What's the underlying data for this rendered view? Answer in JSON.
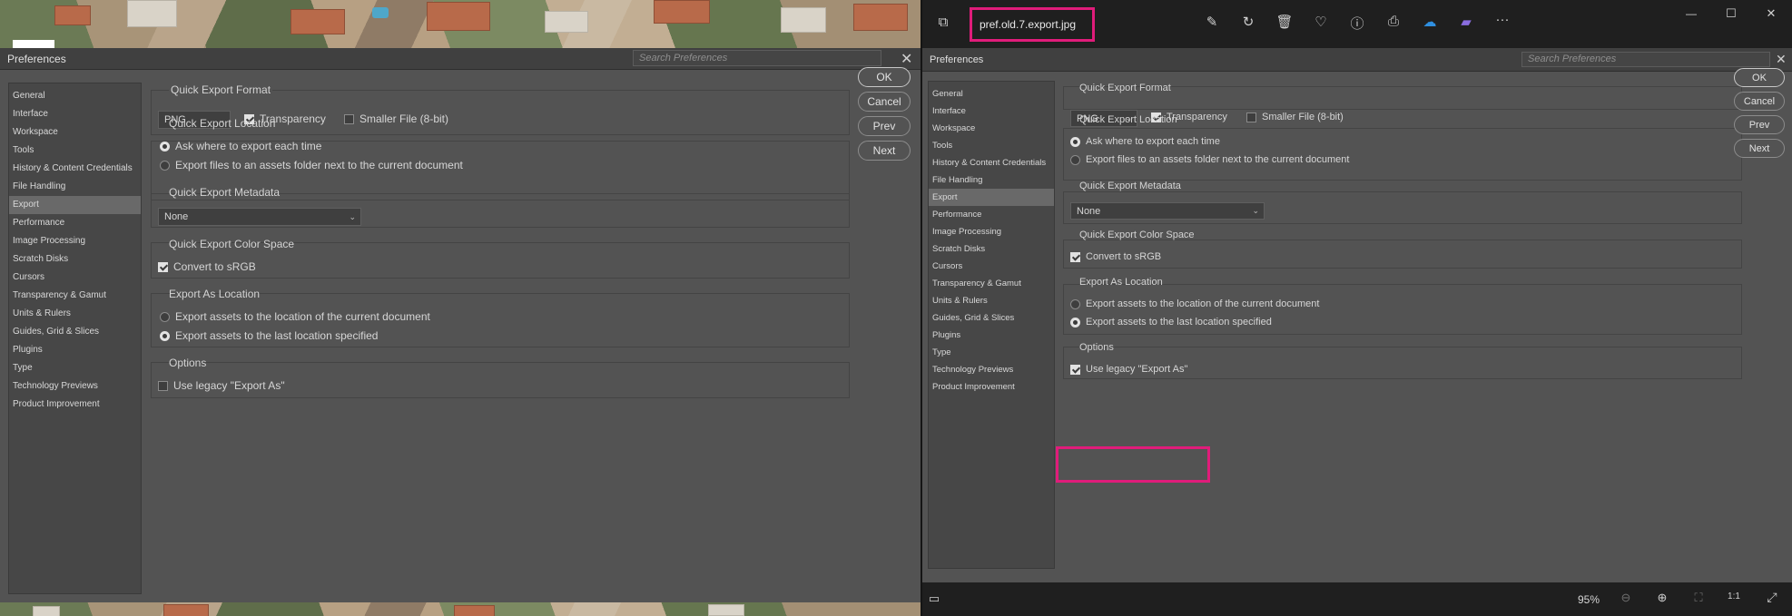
{
  "left": {
    "title": "Preferences",
    "search_placeholder": "Search Preferences",
    "close": "✕",
    "sidebar": [
      "General",
      "Interface",
      "Workspace",
      "Tools",
      "History & Content Credentials",
      "File Handling",
      "Export",
      "Performance",
      "Image Processing",
      "Scratch Disks",
      "Cursors",
      "Transparency & Gamut",
      "Units & Rulers",
      "Guides, Grid & Slices",
      "Plugins",
      "Type",
      "Technology Previews",
      "Product Improvement"
    ],
    "selected": "Export",
    "format": {
      "title": "Quick Export Format",
      "value": "PNG",
      "transparency": "Transparency",
      "smaller": "Smaller File (8-bit)"
    },
    "location": {
      "title": "Quick Export Location",
      "ask": "Ask where to export each time",
      "assets": "Export files to an assets folder next to the current document"
    },
    "metadata": {
      "title": "Quick Export Metadata",
      "value": "None"
    },
    "colorspace": {
      "title": "Quick Export Color Space",
      "srgb": "Convert to sRGB"
    },
    "exportas": {
      "title": "Export As Location",
      "current": "Export assets to the location of the current document",
      "last": "Export assets to the last location specified"
    },
    "options": {
      "title": "Options",
      "legacy": "Use legacy \"Export As\""
    },
    "buttons": {
      "ok": "OK",
      "cancel": "Cancel",
      "prev": "Prev",
      "next": "Next"
    }
  },
  "viewer": {
    "filename": "pref.old.7.export.jpg",
    "zoom": "95%",
    "toolbar_icons": [
      "edit-icon",
      "rotate-icon",
      "delete-icon",
      "favorite-icon",
      "info-icon",
      "print-icon",
      "onedrive-icon",
      "clipchamp-icon",
      "more-icon"
    ],
    "more": "···",
    "window": {
      "minimize": "—",
      "maximize": "☐",
      "close": "✕"
    }
  },
  "right": {
    "title": "Preferences",
    "search_placeholder": "Search Preferences",
    "close": "✕",
    "sidebar": [
      "General",
      "Interface",
      "Workspace",
      "Tools",
      "History & Content Credentials",
      "File Handling",
      "Export",
      "Performance",
      "Image Processing",
      "Scratch Disks",
      "Cursors",
      "Transparency & Gamut",
      "Units & Rulers",
      "Guides, Grid & Slices",
      "Plugins",
      "Type",
      "Technology Previews",
      "Product Improvement"
    ],
    "selected": "Export",
    "format": {
      "title": "Quick Export Format",
      "value": "PNG",
      "transparency": "Transparency",
      "smaller": "Smaller File (8-bit)"
    },
    "location": {
      "title": "Quick Export Location",
      "ask": "Ask where to export each time",
      "assets": "Export files to an assets folder next to the current document"
    },
    "metadata": {
      "title": "Quick Export Metadata",
      "value": "None"
    },
    "colorspace": {
      "title": "Quick Export Color Space",
      "srgb": "Convert to sRGB"
    },
    "exportas": {
      "title": "Export As Location",
      "current": "Export assets to the location of the current document",
      "last": "Export assets to the last location specified"
    },
    "options": {
      "title": "Options",
      "legacy": "Use legacy \"Export As\""
    },
    "buttons": {
      "ok": "OK",
      "cancel": "Cancel",
      "prev": "Prev",
      "next": "Next"
    }
  },
  "colors": {
    "highlight": "#e01c7a",
    "panel": "#535353",
    "titlebar": "#404040",
    "viewer_chrome": "#1f1f1f"
  }
}
